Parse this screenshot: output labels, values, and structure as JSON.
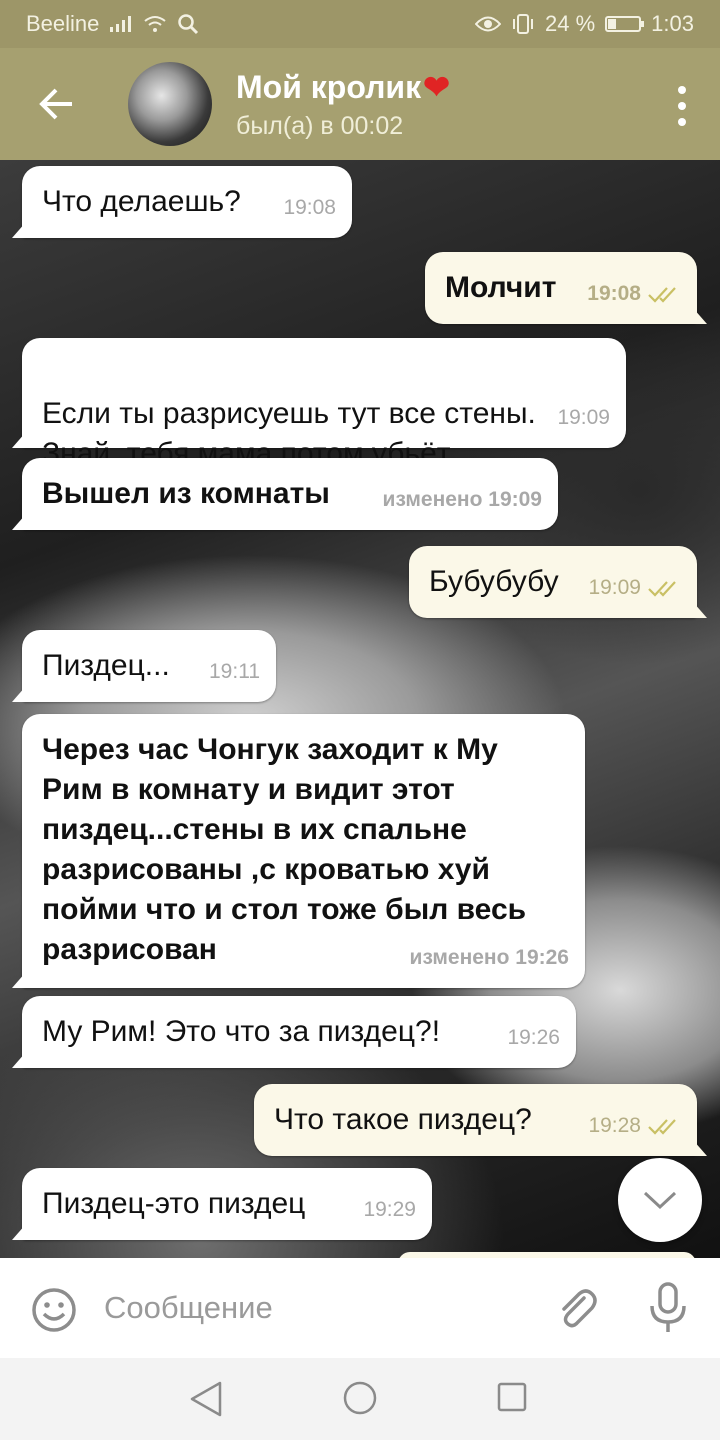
{
  "status_bar": {
    "carrier": "Beeline",
    "battery": "24 %",
    "battery_level": 0.24,
    "time": "1:03"
  },
  "header": {
    "name": "Мой кролик",
    "name_emoji": "❤",
    "status": "был(а) в 00:02",
    "back_icon": "arrow-left-icon",
    "menu_icon": "more-vertical-icon"
  },
  "messages": [
    {
      "direction": "in",
      "text": "Что делаешь?",
      "time": "19:08"
    },
    {
      "direction": "out",
      "text": "Молчит",
      "time": "19:08",
      "read": true
    },
    {
      "direction": "in",
      "text": "Если ты разрисуешь тут все стены.\nЗнай, тебя мама потом убьёт",
      "time": "19:09"
    },
    {
      "direction": "in",
      "text": "Вышел из комнаты",
      "time": "изменено 19:09"
    },
    {
      "direction": "out",
      "text": "Бубубубу",
      "time": "19:09",
      "read": true
    },
    {
      "direction": "in",
      "text": "Пиздец...",
      "time": "19:11"
    },
    {
      "direction": "in",
      "text": "Через час Чонгук заходит к Му Рим в комнату и видит этот пиздец...стены в их спальне разрисованы ,с кроватью хуй пойми что и стол тоже был весь разрисован",
      "time": "изменено 19:26"
    },
    {
      "direction": "in",
      "text": "Му Рим! Это что за пиздец?!",
      "time": "19:26"
    },
    {
      "direction": "out",
      "text": "Что такое пиздец?",
      "time": "19:28",
      "read": true
    },
    {
      "direction": "in",
      "text": "Пиздец-это пиздец",
      "time": "19:29"
    }
  ],
  "composer": {
    "placeholder": "Сообщение",
    "emoji_icon": "smile-icon",
    "attach_icon": "paperclip-icon",
    "mic_icon": "microphone-icon"
  },
  "colors": {
    "header": "#a6a070",
    "status_bar": "#9d9668",
    "outgoing_bubble": "#fbf8e8",
    "incoming_bubble": "#ffffff",
    "check": "#c9c064"
  }
}
